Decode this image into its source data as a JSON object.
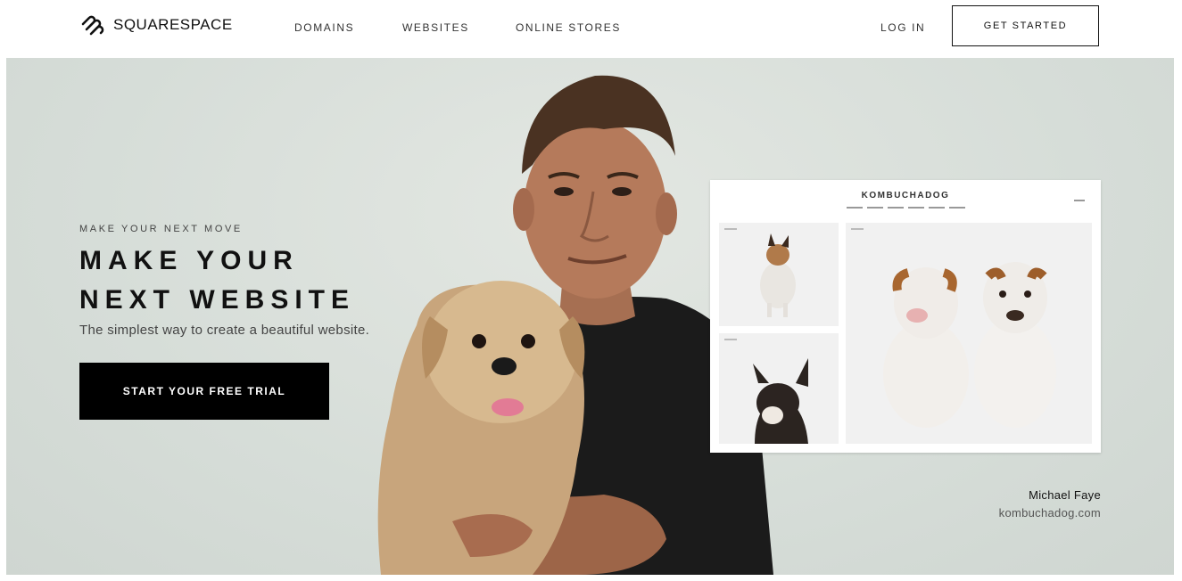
{
  "nav": {
    "logo_text": "SQUARESPACE",
    "links": [
      "DOMAINS",
      "WEBSITES",
      "ONLINE STORES"
    ],
    "login_label": "LOG IN",
    "get_started_label": "GET STARTED"
  },
  "hero": {
    "eyebrow": "MAKE YOUR NEXT MOVE",
    "headline_line1": "MAKE YOUR",
    "headline_line2": "NEXT WEBSITE",
    "subheading": "The simplest way to create a beautiful website.",
    "cta_label": "START YOUR FREE TRIAL",
    "background_color": "#d8ded9"
  },
  "showcase": {
    "site_title": "KOMBUCHADOG",
    "credit_name": "Michael Faye",
    "credit_url": "kombuchadog.com"
  }
}
